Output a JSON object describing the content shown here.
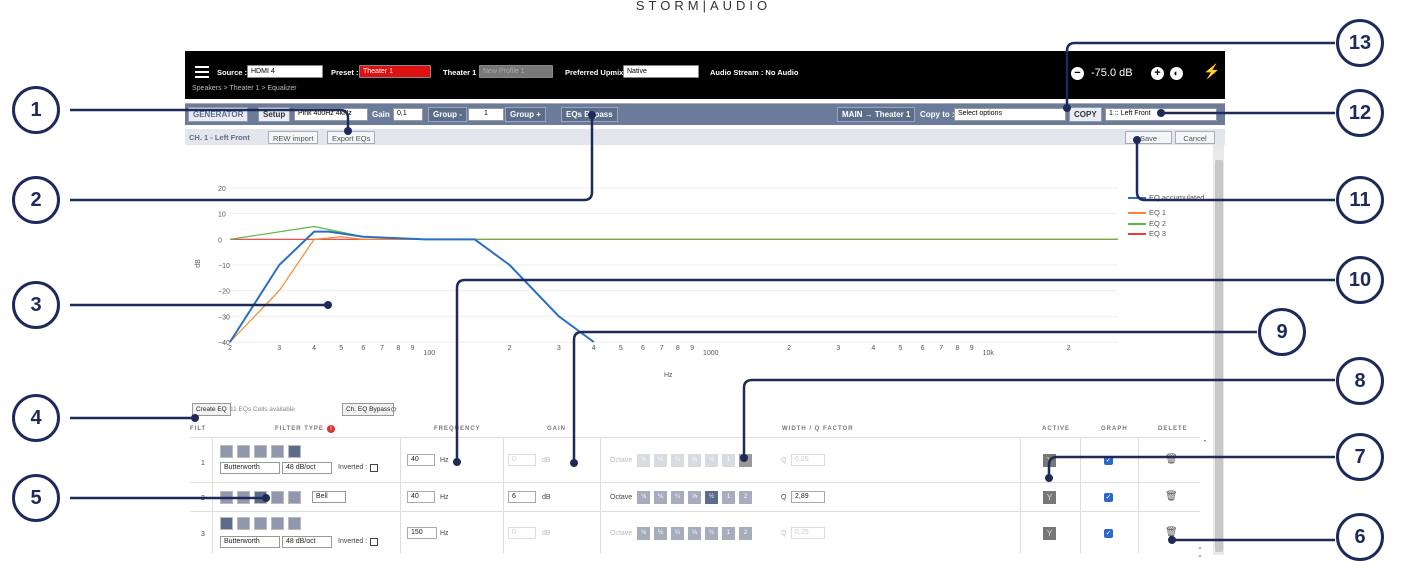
{
  "brand": "STORM|AUDIO",
  "topbar": {
    "source_label": "Source :",
    "source_value": "HDMI 4",
    "preset_label": "Preset :",
    "preset_value": "Theater 1",
    "theater_label": "Theater 1 :",
    "theater_value": "New Profile 1",
    "upmix_label": "Preferred Upmix :",
    "upmix_value": "Native",
    "stream": "Audio Stream : No Audio",
    "volume": "-75.0 dB",
    "breadcrumb": "Speakers  >  Theater 1  >  Equalizer"
  },
  "toolbar": {
    "generator": "GENERATOR",
    "setup": "Setup",
    "signal": "Pink 400Hz 4kHz",
    "gain_label": "Gain",
    "gain_value": "0,1",
    "group_minus": "Group -",
    "group_value": "1",
    "group_plus": "Group +",
    "eq_bypass": "EQs Bypass",
    "route": "MAIN → Theater 1",
    "copy_to": "Copy to :",
    "copy_select": "Select options",
    "copy": "COPY",
    "channel_select": "1 :: Left Front"
  },
  "tabs": {
    "channel": "CH. 1 - Left Front",
    "rew": "REW import",
    "export": "Export EQs",
    "save": "Save",
    "cancel": "Cancel"
  },
  "chart_data": {
    "type": "line",
    "ylabel": "dB",
    "xlabel": "Hz",
    "ylim": [
      -40,
      20
    ],
    "yticks": [
      "20",
      "10",
      "0",
      "−10",
      "−20",
      "−30",
      "−40"
    ],
    "xticks": [
      "2",
      "3",
      "4",
      "5",
      "6",
      "7",
      "8",
      "9",
      "100",
      "2",
      "3",
      "4",
      "5",
      "6",
      "7",
      "8",
      "9",
      "1000",
      "2",
      "3",
      "4",
      "5",
      "6",
      "7",
      "8",
      "9",
      "10k",
      "2"
    ],
    "legend": [
      "EQ accumulated",
      "EQ 1",
      "EQ 2",
      "EQ 3"
    ],
    "series_colors": [
      "#2a6fc4",
      "#f28a2e",
      "#5cb83d",
      "#e63c3c"
    ],
    "series": [
      {
        "name": "EQ accumulated",
        "x": [
          20,
          30,
          40,
          45,
          60,
          100,
          150,
          200,
          300,
          400
        ],
        "y": [
          -40,
          -10,
          3,
          3,
          1,
          0,
          0,
          -10,
          -30,
          -40
        ]
      },
      {
        "name": "EQ 1",
        "x": [
          20,
          30,
          40,
          50,
          60,
          100,
          150,
          200,
          300,
          400
        ],
        "y": [
          -40,
          -20,
          0,
          1,
          0,
          0,
          0,
          -10,
          -30,
          -40
        ]
      },
      {
        "name": "EQ 2",
        "x": [
          20,
          40,
          60,
          100,
          10000,
          30000
        ],
        "y": [
          0,
          5,
          1,
          0,
          0,
          0
        ]
      },
      {
        "name": "EQ 3",
        "x": [
          20,
          100,
          1000,
          30000
        ],
        "y": [
          0,
          0,
          0,
          0
        ]
      }
    ]
  },
  "eqlist": {
    "create": "Create EQ",
    "available": "11 EQs Cells available",
    "bypass": "Ch. EQ Bypass"
  },
  "table": {
    "headers": {
      "filt": "FILT",
      "type": "FILTER TYPE",
      "freq": "FREQUENCY",
      "gain": "GAIN",
      "width": "WIDTH / Q FACTOR",
      "active": "ACTIVE",
      "graph": "GRAPH",
      "delete": "DELETE"
    },
    "rows": [
      {
        "num": "1",
        "filter": "Butterworth",
        "slope": "48 dB/oct",
        "inverted": "Inverted :",
        "freq": "40",
        "gain": "0",
        "q": "0,25"
      },
      {
        "num": "2",
        "filter": "Bell",
        "slope": "",
        "inverted": "",
        "freq": "40",
        "gain": "6",
        "q": "2,89"
      },
      {
        "num": "3",
        "filter": "Butterworth",
        "slope": "48 dB/oct",
        "inverted": "Inverted :",
        "freq": "150",
        "gain": "0",
        "q": "0,25"
      }
    ],
    "hz": "Hz",
    "db": "dB",
    "octave": "Octave",
    "q": "Q",
    "octaves": [
      "⅛",
      "⅙",
      "¼",
      "⅓",
      "½",
      "1",
      "2"
    ]
  },
  "callouts": [
    "1",
    "2",
    "3",
    "4",
    "5",
    "6",
    "7",
    "8",
    "9",
    "10",
    "11",
    "12",
    "13"
  ]
}
